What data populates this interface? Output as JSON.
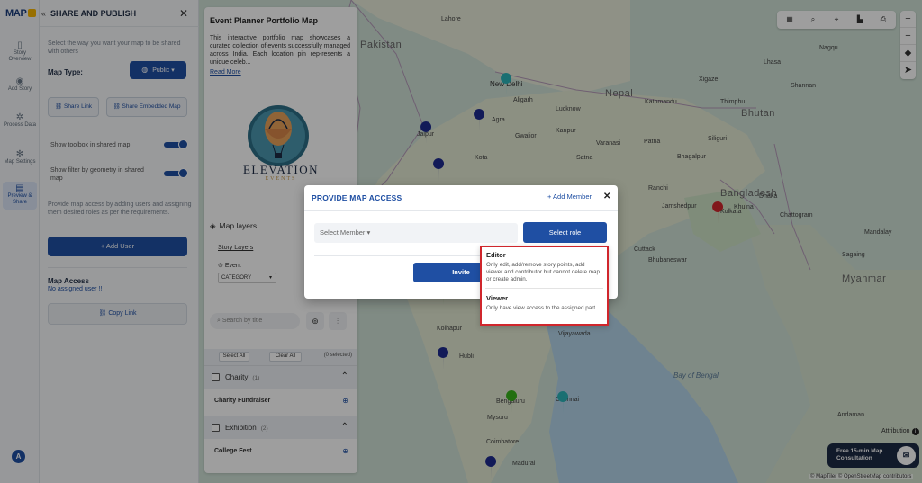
{
  "app": {
    "logo_text": "MAP",
    "accent": "#1f4fa3",
    "dark": "#1c2a44",
    "highlight": "#d0262c"
  },
  "rail": {
    "items": [
      {
        "label": "Story Overview",
        "icon": "book-icon"
      },
      {
        "label": "Add Story",
        "icon": "location-pin-icon"
      },
      {
        "label": "Process Data",
        "icon": "gear-icon"
      },
      {
        "label": "Map Settings",
        "icon": "settings-icon"
      },
      {
        "label": "Preview & Share",
        "icon": "share-icon",
        "active": true
      }
    ],
    "avatar": "A"
  },
  "share": {
    "title": "SHARE AND PUBLISH",
    "description": "Select the way you want your map to be shared with others",
    "map_type_label": "Map Type:",
    "map_type_value": "Public",
    "share_link": "Share Link",
    "share_embedded": "Share Embedded Map",
    "toggle_toolbox": "Show toolbox in shared map",
    "toggle_filter": "Show filter by geometry in shared map",
    "access_description": "Provide map access by adding users and assigning them desired roles as per the requirements.",
    "add_user": "+ Add User",
    "access_title": "Map Access",
    "access_status": "No assigned user !!",
    "copy_link": "Copy Link"
  },
  "story": {
    "title": "Event Planner Portfolio Map",
    "description": "This interactive portfolio map showcases a curated collection of events successfully managed across India. Each location pin rep-resents a unique celeb...",
    "read_more": "Read More",
    "brand_name": "ELEVATION",
    "brand_sub": "EVENTS",
    "layers_title": "Map layers",
    "story_layers": "Story Layers",
    "event_label": "Event",
    "category_select": "CATEGORY",
    "search_placeholder": "Search by title",
    "select_all": "Select All",
    "clear_all": "Clear All",
    "selected_count": "(0 selected)",
    "categories": [
      {
        "name": "Charity",
        "count": "(1)",
        "items": [
          "Charity Fundraiser"
        ]
      },
      {
        "name": "Exhibition",
        "count": "(2)",
        "items": [
          "College Fest"
        ]
      }
    ]
  },
  "map": {
    "labels": {
      "pakistan": "Pakistan",
      "nepal": "Nepal",
      "bhutan": "Bhutan",
      "bangladesh": "Bangladesh",
      "myanmar": "Myanmar",
      "new_delhi": "New Delhi",
      "lahore": "Lahore",
      "kathmandu": "Kathmandu",
      "thimphu": "Thimphu",
      "lhasa": "Lhasa",
      "kolkata": "Kolkata",
      "dhaka": "Dhaka",
      "patna": "Patna",
      "lucknow": "Lucknow",
      "kanpur": "Kanpur",
      "agra": "Agra",
      "aligarh": "Aligarh",
      "gwalior": "Gwalior",
      "jaipur": "Jaipur",
      "kota": "Kota",
      "bhubaneswar": "Bhubaneswar",
      "vijayawada": "Vijayawada",
      "hubli": "Hubli",
      "kolhapur": "Kolhapur",
      "bengaluru": "Bengaluru",
      "chennai": "Chennai",
      "mysuru": "Mysuru",
      "coimbatore": "Coimbatore",
      "madurai": "Madurai",
      "jamshedpur": "Jamshedpur",
      "chattogram": "Chattogram",
      "mandalay": "Mandalay",
      "sagaing": "Sagaing",
      "bay": "Bay of Bengal",
      "andaman": "Andaman",
      "xigaze": "Xigaze",
      "nagqu": "Nagqu",
      "shannan": "Shannan",
      "khulna": "Khulna",
      "cuttack": "Cuttack",
      "varanasi": "Varanasi",
      "satna": "Satna",
      "bhagalpur": "Bhagalpur",
      "ranchi": "Ranchi",
      "siliguri": "Siliguri"
    },
    "toolbar": [
      "layers-icon",
      "search-icon",
      "pin-drop-icon",
      "building-icon",
      "print-icon",
      "fullscreen-icon"
    ],
    "zoom": [
      "+",
      "−",
      "⬥",
      "➤"
    ],
    "attribution": "Attribution",
    "copyright": "© MapTiler © OpenStreetMap contributors",
    "consult": "Free 15-min Map Consultation"
  },
  "modal": {
    "title": "PROVIDE MAP ACCESS",
    "add_member": "+ Add Member",
    "select_member": "Select Member",
    "select_role": "Select role",
    "invite": "Invite",
    "roles": [
      {
        "name": "Editor",
        "description": "Only edit, add/remove story points, add viewer and contributor but cannot delete map or create admin."
      },
      {
        "name": "Viewer",
        "description": "Only have view access to the assigned part."
      }
    ]
  }
}
